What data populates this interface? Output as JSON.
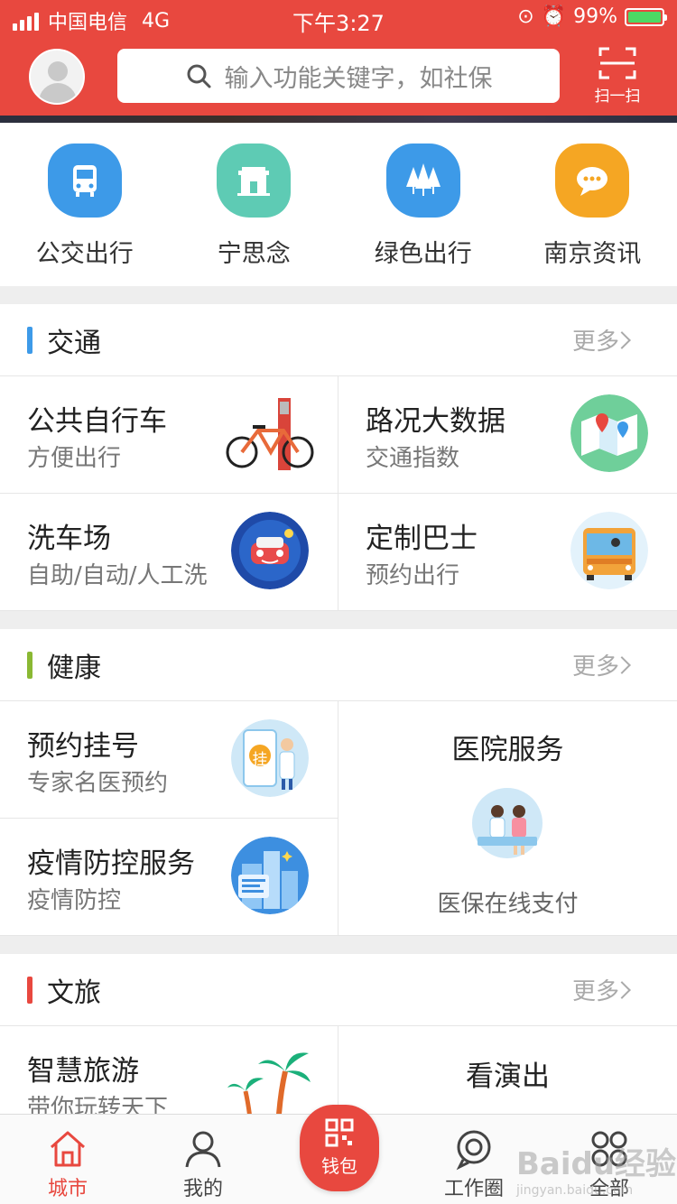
{
  "status_bar": {
    "carrier": "中国电信",
    "network": "4G",
    "time": "下午3:27",
    "battery_percent": "99%",
    "battery_level": 0.99
  },
  "header": {
    "search_placeholder": "输入功能关键字，如社保",
    "scan_label": "扫一扫",
    "colors": {
      "header_bg": "#e8483f"
    }
  },
  "quick_links": [
    {
      "label": "公交出行",
      "icon": "bus-icon",
      "color": "#3d9ae8"
    },
    {
      "label": "宁思念",
      "icon": "gate-icon",
      "color": "#5ecbb4"
    },
    {
      "label": "绿色出行",
      "icon": "trees-icon",
      "color": "#3d9ae8"
    },
    {
      "label": "南京资讯",
      "icon": "chat-bubble-icon",
      "color": "#f5a623"
    }
  ],
  "sections": {
    "traffic": {
      "title": "交通",
      "more": "更多",
      "accent": "#3d9ae8",
      "cells": [
        {
          "title": "公共自行车",
          "subtitle": "方便出行",
          "icon": "bicycle-icon"
        },
        {
          "title": "路况大数据",
          "subtitle": "交通指数",
          "icon": "map-pin-icon"
        },
        {
          "title": "洗车场",
          "subtitle": "自助/自动/人工洗",
          "icon": "car-wash-icon"
        },
        {
          "title": "定制巴士",
          "subtitle": "预约出行",
          "icon": "bus-front-icon"
        }
      ]
    },
    "health": {
      "title": "健康",
      "more": "更多",
      "accent": "#8ab833",
      "cells": [
        {
          "title": "预约挂号",
          "subtitle": "专家名医预约",
          "icon": "registration-icon",
          "badge": "挂"
        },
        {
          "title": "疫情防控服务",
          "subtitle": "疫情防控",
          "icon": "city-icon"
        }
      ],
      "feature": {
        "title": "医院服务",
        "subtitle": "医保在线支付",
        "icon": "doctor-patient-icon"
      }
    },
    "culture": {
      "title": "文旅",
      "more": "更多",
      "accent": "#e8483f",
      "cells": [
        {
          "title": "智慧旅游",
          "subtitle": "带你玩转天下",
          "icon": "palm-tree-icon"
        }
      ],
      "feature": {
        "title": "看演出"
      }
    }
  },
  "tabbar": {
    "tabs": [
      {
        "label": "城市",
        "icon": "home-icon",
        "active": true
      },
      {
        "label": "我的",
        "icon": "person-icon",
        "active": false
      },
      {
        "label": "钱包",
        "icon": "qr-wallet-icon",
        "active": false
      },
      {
        "label": "工作圈",
        "icon": "circle-chat-icon",
        "active": false
      },
      {
        "label": "全部",
        "icon": "grid-icon",
        "active": false
      }
    ]
  },
  "watermark": {
    "text": "Baidu经验",
    "sub": "jingyan.baidu.com"
  }
}
